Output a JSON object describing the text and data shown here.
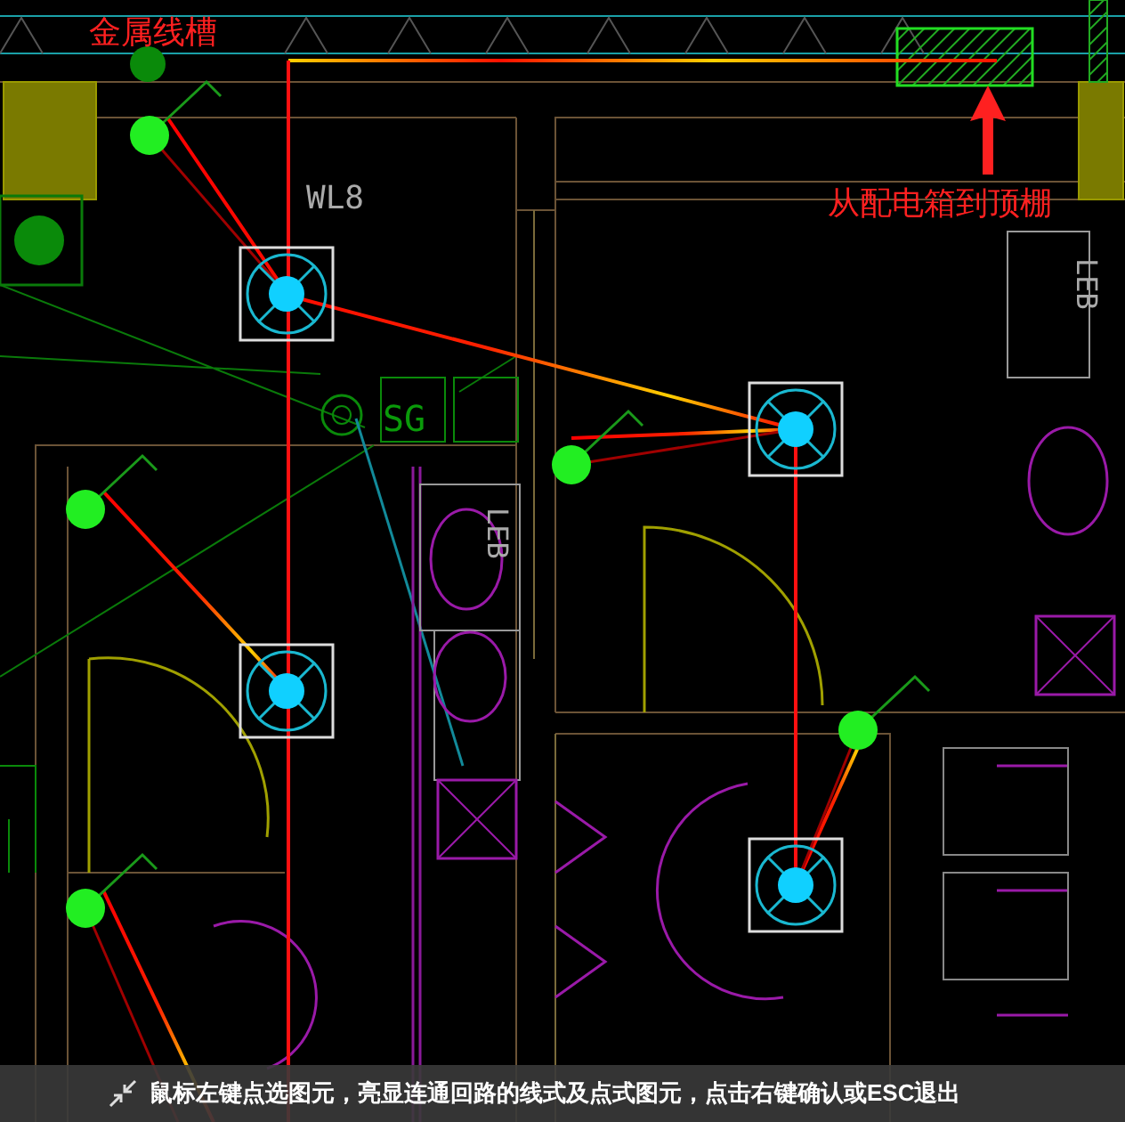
{
  "annotations": [
    {
      "text": "金属线槽"
    },
    {
      "text": "从配电箱到顶棚"
    }
  ],
  "drawing_labels": [
    {
      "text": "WL8",
      "kind": "horizontal"
    },
    {
      "text": "LEB",
      "kind": "vertical"
    },
    {
      "text": "LEB",
      "kind": "vertical"
    },
    {
      "text": "SG",
      "kind": "horizontal"
    }
  ],
  "status_bar": {
    "message": "鼠标左键点选图元，亮显连通回路的线式及点式图元，点击右键确认或ESC退出"
  }
}
